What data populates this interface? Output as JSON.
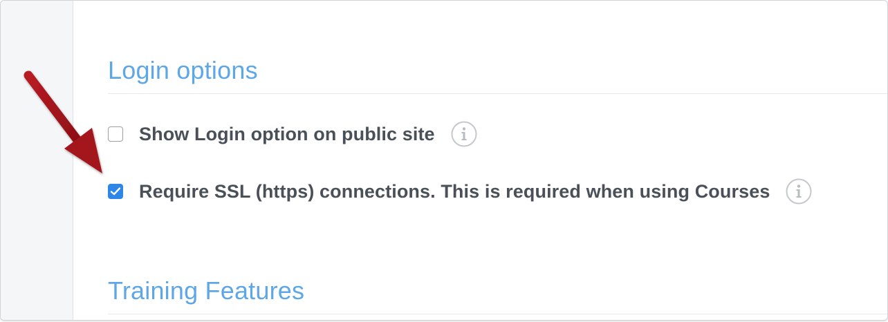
{
  "sections": {
    "login": {
      "title": "Login options",
      "options": [
        {
          "label": "Show Login option on public site",
          "checked": false
        },
        {
          "label": "Require SSL (https) connections. This is required when using Courses",
          "checked": true
        }
      ]
    },
    "training": {
      "title": "Training Features"
    }
  },
  "icons": {
    "info": "info-icon",
    "checkmark": "checkmark-icon",
    "annotation": "arrow-annotation"
  },
  "colors": {
    "section_title": "#5ea7e6",
    "label_text": "#4a5058",
    "checkbox_checked": "#2f86e6",
    "annotation_arrow": "#a3141c"
  }
}
